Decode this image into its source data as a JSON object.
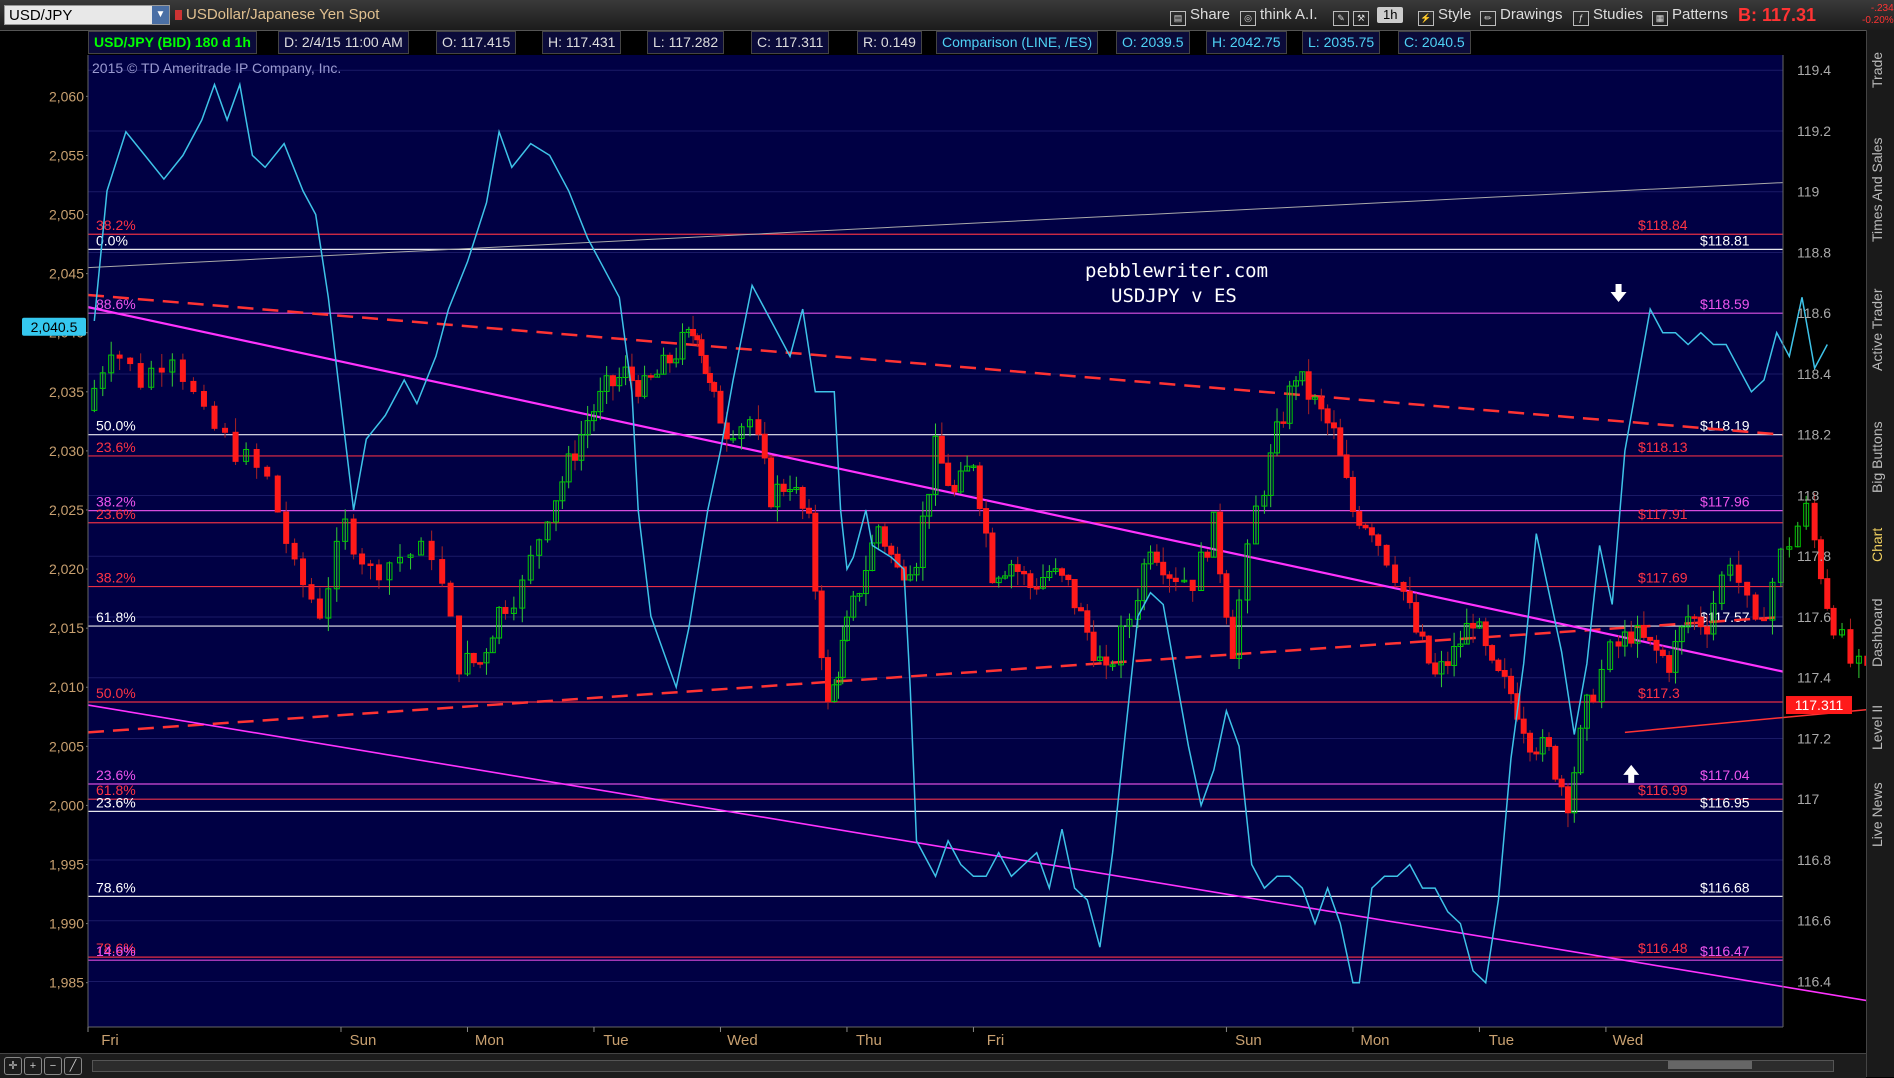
{
  "header": {
    "symbol": "USD/JPY",
    "description": "USDollar/Japanese Yen Spot",
    "menu": [
      {
        "label": "Share",
        "icon": "share-icon"
      },
      {
        "label": "think A.I.",
        "icon": "brain-icon"
      },
      {
        "label": "1h",
        "icon": "timeframe-icon"
      },
      {
        "label": "Style",
        "icon": "style-icon"
      },
      {
        "label": "Drawings",
        "icon": "pencil-icon"
      },
      {
        "label": "Studies",
        "icon": "studies-icon"
      },
      {
        "label": "Patterns",
        "icon": "patterns-icon"
      }
    ],
    "bid": "B: 117.31",
    "change": [
      "-.234",
      "-0.20%"
    ]
  },
  "infobar": {
    "title": "USD/JPY (BID) 180 d 1h",
    "date": "D: 2/4/15 11:00 AM",
    "open": "O: 117.415",
    "high": "H: 117.431",
    "low": "L: 117.282",
    "close": "C: 117.311",
    "range": "R: 0.149",
    "comparison": "Comparison (LINE, /ES)",
    "cmp_open": "O: 2039.5",
    "cmp_high": "H: 2042.75",
    "cmp_low": "L: 2035.75",
    "cmp_close": "C: 2040.5"
  },
  "copyright": "2015 © TD Ameritrade IP Company, Inc.",
  "watermark": [
    "pebblewriter.com",
    "USDJPY v ES"
  ],
  "right_tabs": [
    "Trade",
    "Times And Sales",
    "Active Trader",
    "Big Buttons",
    "Chart",
    "Dashboard",
    "Level II",
    "Live News"
  ],
  "colors": {
    "background": "#000044",
    "up_candle": "#00cc00",
    "down_candle": "#ff1a1a",
    "comparison_line": "#3ec3e8",
    "magenta": "#ff33ff",
    "fib_red": "#ff3344",
    "fib_white": "#ffffff",
    "fib_magenta": "#ee55ee"
  },
  "chart_data": {
    "type": "line",
    "title": "USD/JPY (BID) 180 d 1h",
    "x_labels": [
      "Fri",
      "Sun",
      "Mon",
      "Tue",
      "Wed",
      "Thu",
      "Fri",
      "Sun",
      "Mon",
      "Tue",
      "Wed"
    ],
    "x_days": [
      0,
      2,
      3,
      4,
      5,
      6,
      7,
      9,
      10,
      11,
      12
    ],
    "x_range": [
      0,
      13.4
    ],
    "ylim_right": [
      116.25,
      119.45
    ],
    "ylim_left": [
      1981.25,
      2063.5
    ],
    "ticks_right": [
      "116.4",
      "116.6",
      "116.8",
      "117",
      "117.2",
      "117.4",
      "117.6",
      "117.8",
      "118",
      "118.2",
      "118.4",
      "118.6",
      "118.8",
      "119",
      "119.2",
      "119.4"
    ],
    "ticks_left": [
      "1,985",
      "1,990",
      "1,995",
      "2,000",
      "2,005",
      "2,010",
      "2,015",
      "2,020",
      "2,025",
      "2,030",
      "2,035",
      "2,040",
      "2,045",
      "2,050",
      "2,055",
      "2,060"
    ],
    "left_marker": "2,040.5",
    "right_marker": "117.311",
    "series": [
      {
        "name": "USD/JPY (BID)",
        "kind": "candlestick",
        "points": [
          [
            0.05,
            118.28
          ],
          [
            0.25,
            118.5
          ],
          [
            0.5,
            118.38
          ],
          [
            0.75,
            118.48
          ],
          [
            1.0,
            118.25
          ],
          [
            1.25,
            118.15
          ],
          [
            1.5,
            118.05
          ],
          [
            1.7,
            117.75
          ],
          [
            1.9,
            117.62
          ],
          [
            2.1,
            117.9
          ],
          [
            2.3,
            117.75
          ],
          [
            2.55,
            117.8
          ],
          [
            2.8,
            117.82
          ],
          [
            3.0,
            117.45
          ],
          [
            3.15,
            117.45
          ],
          [
            3.3,
            117.62
          ],
          [
            3.5,
            117.7
          ],
          [
            3.7,
            117.95
          ],
          [
            3.85,
            118.1
          ],
          [
            4.0,
            118.25
          ],
          [
            4.15,
            118.35
          ],
          [
            4.3,
            118.4
          ],
          [
            4.45,
            118.35
          ],
          [
            4.6,
            118.42
          ],
          [
            4.75,
            118.5
          ],
          [
            4.85,
            118.55
          ],
          [
            4.95,
            118.35
          ],
          [
            5.1,
            118.22
          ],
          [
            5.3,
            118.25
          ],
          [
            5.45,
            118.0
          ],
          [
            5.6,
            118.05
          ],
          [
            5.75,
            117.9
          ],
          [
            5.9,
            117.3
          ],
          [
            6.0,
            117.5
          ],
          [
            6.15,
            117.7
          ],
          [
            6.3,
            117.9
          ],
          [
            6.45,
            117.75
          ],
          [
            6.6,
            117.8
          ],
          [
            6.75,
            118.15
          ],
          [
            6.9,
            118.0
          ],
          [
            7.05,
            118.12
          ],
          [
            7.2,
            117.75
          ],
          [
            7.35,
            117.78
          ],
          [
            7.5,
            117.7
          ],
          [
            7.65,
            117.75
          ],
          [
            7.8,
            117.7
          ],
          [
            7.95,
            117.55
          ],
          [
            8.1,
            117.4
          ],
          [
            8.3,
            117.6
          ],
          [
            8.45,
            117.85
          ],
          [
            8.6,
            117.75
          ],
          [
            8.8,
            117.72
          ],
          [
            8.95,
            117.9
          ],
          [
            9.1,
            117.5
          ],
          [
            9.3,
            117.95
          ],
          [
            9.45,
            118.2
          ],
          [
            9.6,
            118.4
          ],
          [
            9.75,
            118.3
          ],
          [
            9.9,
            118.2
          ],
          [
            10.05,
            117.95
          ],
          [
            10.2,
            117.9
          ],
          [
            10.4,
            117.75
          ],
          [
            10.55,
            117.55
          ],
          [
            10.7,
            117.4
          ],
          [
            10.85,
            117.48
          ],
          [
            11.0,
            117.6
          ],
          [
            11.15,
            117.42
          ],
          [
            11.3,
            117.35
          ],
          [
            11.45,
            117.2
          ],
          [
            11.6,
            117.15
          ],
          [
            11.75,
            117.0
          ],
          [
            11.9,
            117.3
          ],
          [
            12.1,
            117.48
          ],
          [
            12.25,
            117.55
          ],
          [
            12.4,
            117.5
          ],
          [
            12.55,
            117.45
          ],
          [
            12.7,
            117.6
          ],
          [
            12.85,
            117.58
          ],
          [
            13.05,
            117.8
          ],
          [
            13.25,
            117.55
          ],
          [
            13.45,
            117.8
          ],
          [
            13.65,
            117.95
          ],
          [
            13.8,
            117.65
          ],
          [
            14.0,
            117.45
          ],
          [
            14.2,
            117.38
          ],
          [
            14.35,
            117.5
          ],
          [
            14.5,
            117.48
          ],
          [
            14.65,
            117.6
          ],
          [
            14.8,
            117.55
          ],
          [
            15.0,
            117.4
          ],
          [
            15.15,
            117.31
          ]
        ]
      },
      {
        "name": "Comparison (LINE, /ES)",
        "kind": "line",
        "points": [
          [
            0.05,
            2041
          ],
          [
            0.15,
            2052
          ],
          [
            0.3,
            2057
          ],
          [
            0.45,
            2055
          ],
          [
            0.6,
            2053
          ],
          [
            0.75,
            2055
          ],
          [
            0.9,
            2058
          ],
          [
            1.0,
            2061
          ],
          [
            1.1,
            2058
          ],
          [
            1.2,
            2061
          ],
          [
            1.3,
            2055
          ],
          [
            1.4,
            2054
          ],
          [
            1.55,
            2056
          ],
          [
            1.7,
            2052
          ],
          [
            1.8,
            2050
          ],
          [
            1.9,
            2043
          ],
          [
            2.1,
            2025
          ],
          [
            2.2,
            2031
          ],
          [
            2.35,
            2033
          ],
          [
            2.5,
            2036
          ],
          [
            2.6,
            2034
          ],
          [
            2.75,
            2038
          ],
          [
            2.85,
            2042
          ],
          [
            3.0,
            2046
          ],
          [
            3.15,
            2051
          ],
          [
            3.25,
            2057
          ],
          [
            3.35,
            2054
          ],
          [
            3.5,
            2056
          ],
          [
            3.65,
            2055
          ],
          [
            3.8,
            2052
          ],
          [
            3.95,
            2048
          ],
          [
            4.05,
            2046
          ],
          [
            4.2,
            2043
          ],
          [
            4.3,
            2035
          ],
          [
            4.35,
            2025
          ],
          [
            4.45,
            2016
          ],
          [
            4.55,
            2013
          ],
          [
            4.65,
            2010
          ],
          [
            4.75,
            2015
          ],
          [
            4.9,
            2025
          ],
          [
            5.0,
            2030
          ],
          [
            5.1,
            2036
          ],
          [
            5.25,
            2044
          ],
          [
            5.4,
            2041
          ],
          [
            5.55,
            2038
          ],
          [
            5.65,
            2042
          ],
          [
            5.75,
            2035
          ],
          [
            5.9,
            2035
          ],
          [
            5.95,
            2025
          ],
          [
            6.0,
            2020
          ],
          [
            6.05,
            2021
          ],
          [
            6.15,
            2025
          ],
          [
            6.2,
            2022
          ],
          [
            6.35,
            2021
          ],
          [
            6.45,
            2020
          ],
          [
            6.5,
            2010
          ],
          [
            6.55,
            1997
          ],
          [
            6.7,
            1994
          ],
          [
            6.8,
            1997
          ],
          [
            6.9,
            1995
          ],
          [
            7.0,
            1994
          ],
          [
            7.1,
            1994
          ],
          [
            7.2,
            1996
          ],
          [
            7.3,
            1994
          ],
          [
            7.4,
            1995
          ],
          [
            7.5,
            1996
          ],
          [
            7.6,
            1993
          ],
          [
            7.7,
            1998
          ],
          [
            7.8,
            1993
          ],
          [
            7.9,
            1992
          ],
          [
            8.0,
            1988
          ],
          [
            8.1,
            1996
          ],
          [
            8.2,
            2006
          ],
          [
            8.3,
            2016
          ],
          [
            8.4,
            2018
          ],
          [
            8.5,
            2017
          ],
          [
            8.6,
            2011
          ],
          [
            8.7,
            2005
          ],
          [
            8.8,
            2000
          ],
          [
            8.9,
            2003
          ],
          [
            9.0,
            2008
          ],
          [
            9.1,
            2005
          ],
          [
            9.2,
            1995
          ],
          [
            9.3,
            1993
          ],
          [
            9.4,
            1994
          ],
          [
            9.5,
            1994
          ],
          [
            9.6,
            1993
          ],
          [
            9.7,
            1990
          ],
          [
            9.8,
            1993
          ],
          [
            9.9,
            1990
          ],
          [
            10.0,
            1985
          ],
          [
            10.05,
            1985
          ],
          [
            10.15,
            1993
          ],
          [
            10.25,
            1994
          ],
          [
            10.35,
            1994
          ],
          [
            10.45,
            1995
          ],
          [
            10.55,
            1993
          ],
          [
            10.65,
            1993
          ],
          [
            10.75,
            1991
          ],
          [
            10.85,
            1990
          ],
          [
            10.95,
            1986
          ],
          [
            11.05,
            1985
          ],
          [
            11.15,
            1992
          ],
          [
            11.25,
            2004
          ],
          [
            11.35,
            2012
          ],
          [
            11.45,
            2023
          ],
          [
            11.55,
            2018
          ],
          [
            11.65,
            2013
          ],
          [
            11.75,
            2006
          ],
          [
            11.85,
            2012
          ],
          [
            11.95,
            2022
          ],
          [
            12.05,
            2017
          ],
          [
            12.15,
            2030
          ],
          [
            12.25,
            2036
          ],
          [
            12.35,
            2042
          ],
          [
            12.45,
            2040
          ],
          [
            12.55,
            2040
          ],
          [
            12.65,
            2039
          ],
          [
            12.75,
            2040
          ],
          [
            12.85,
            2039
          ],
          [
            12.95,
            2039
          ],
          [
            13.05,
            2037
          ],
          [
            13.15,
            2035
          ],
          [
            13.25,
            2036
          ],
          [
            13.35,
            2040
          ],
          [
            13.45,
            2038
          ],
          [
            13.55,
            2043
          ],
          [
            13.65,
            2037
          ],
          [
            13.75,
            2039
          ]
        ]
      }
    ],
    "fib_levels": [
      {
        "label": "38.2%",
        "price_label": "$118.84",
        "color": "red"
      },
      {
        "label": "0.0%",
        "price_label": "$118.81",
        "color": "white"
      },
      {
        "label": "88.6%",
        "price_label": "$118.59",
        "color": "magenta"
      },
      {
        "label": "50.0%",
        "price_label": "$118.19",
        "color": "white"
      },
      {
        "label": "23.6%",
        "price_label": "$118.13",
        "color": "red"
      },
      {
        "label": "38.2%",
        "price_label": "$117.96",
        "color": "magenta"
      },
      {
        "label": "23.6%",
        "price_label": "$117.91",
        "color": "red"
      },
      {
        "label": "38.2%",
        "price_label": "$117.69",
        "color": "red"
      },
      {
        "label": "61.8%",
        "price_label": "$117.57",
        "color": "white"
      },
      {
        "label": "50.0%",
        "price_label": "$117.3",
        "color": "red"
      },
      {
        "label": "23.6%",
        "price_label": "$117.04",
        "color": "magenta"
      },
      {
        "label": "61.8%",
        "price_label": "$116.99",
        "color": "red"
      },
      {
        "label": "23.6%",
        "price_label": "$116.95",
        "color": "white"
      },
      {
        "label": "78.6%",
        "price_label": "$116.68",
        "color": "white"
      },
      {
        "label": "78.6%",
        "price_label": "$116.48",
        "color": "red"
      },
      {
        "label": "14.6%",
        "price_label": "$116.47",
        "color": "magenta"
      }
    ],
    "trendlines": [
      {
        "name": "upper-dashed",
        "style": "dashed",
        "color": "red"
      },
      {
        "name": "lower-dashed",
        "style": "dashed",
        "color": "red"
      },
      {
        "name": "magenta-diagonal",
        "style": "solid",
        "color": "magenta"
      },
      {
        "name": "lower-magenta",
        "style": "solid",
        "color": "magenta"
      },
      {
        "name": "grey-rising",
        "style": "solid",
        "color": "grey"
      },
      {
        "name": "recent-support",
        "style": "solid",
        "color": "red"
      }
    ],
    "arrows": [
      {
        "direction": "down"
      },
      {
        "direction": "up"
      }
    ]
  }
}
